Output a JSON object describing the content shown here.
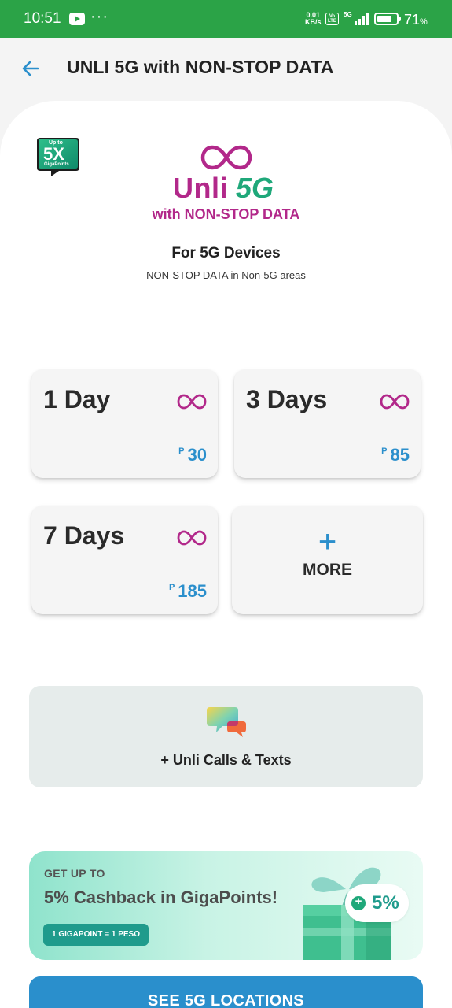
{
  "status_bar": {
    "time": "10:51",
    "net_speed": "0.01",
    "net_unit": "KB/s",
    "volte": "Vo LTE",
    "network": "5G",
    "battery": "71",
    "battery_unit": "%"
  },
  "header": {
    "title": "UNLI 5G with NON-STOP DATA"
  },
  "promo": {
    "badge_top": "Up to",
    "badge_main": "5X",
    "badge_sub": "GigaPoints",
    "logo_word": "Unli",
    "logo_5g": "5G",
    "tagline": "with NON-STOP DATA",
    "devices_title": "For 5G Devices",
    "devices_sub": "NON-STOP DATA in Non-5G areas"
  },
  "plans": [
    {
      "name": "1 Day",
      "currency": "P",
      "price": "30"
    },
    {
      "name": "3 Days",
      "currency": "P",
      "price": "85"
    },
    {
      "name": "7 Days",
      "currency": "P",
      "price": "185"
    }
  ],
  "more": {
    "plus": "+",
    "label": "MORE"
  },
  "addon": {
    "label": "+ Unli Calls & Texts"
  },
  "cashback": {
    "kicker": "GET UP TO",
    "title": "5% Cashback in GigaPoints!",
    "pill": "1 GIGAPOINT = 1 PESO",
    "percent": "5%"
  },
  "cta": {
    "label": "SEE 5G LOCATIONS"
  },
  "colors": {
    "status_green": "#2ba347",
    "brand_magenta": "#b2288a",
    "brand_blue": "#2b8fcc",
    "brand_teal": "#1f9b8c"
  },
  "icons": [
    "back-arrow-icon",
    "youtube-icon",
    "infinity-icon",
    "chat-bubbles-icon",
    "gift-icon",
    "coin-icon"
  ]
}
